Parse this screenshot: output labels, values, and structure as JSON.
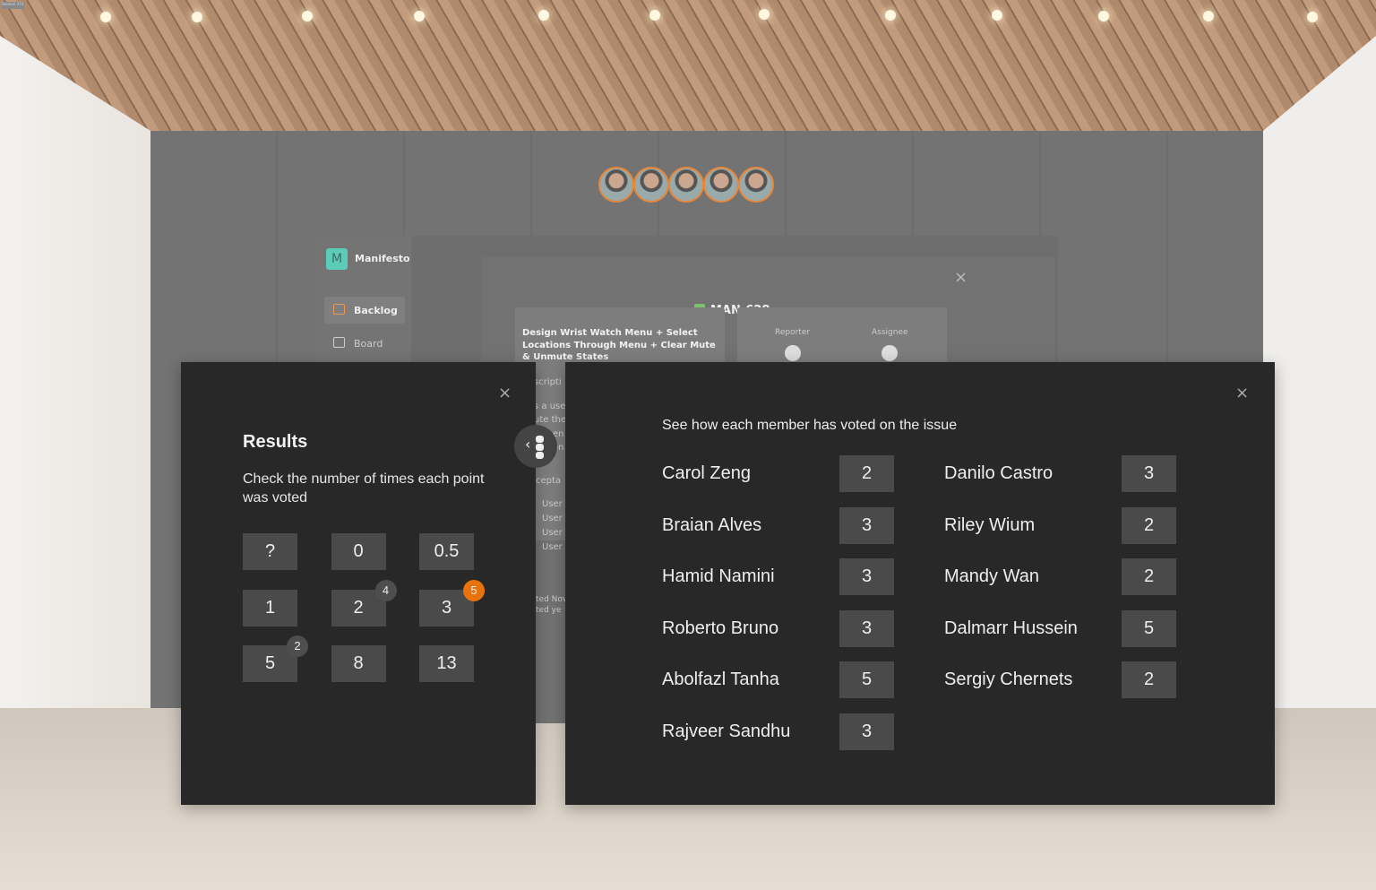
{
  "session_tag": "Session 374",
  "app": {
    "brand": "Manifesto",
    "brand_initial": "M",
    "nav": [
      {
        "label": "Backlog",
        "active": true
      },
      {
        "label": "Board",
        "active": false
      }
    ]
  },
  "issue": {
    "key": "MAN-628",
    "title": "Design Wrist Watch Menu + Select Locations Through Menu + Clear Mute & Unmute States",
    "reporter_label": "Reporter",
    "assignee_label": "Assignee",
    "fragments": [
      "scripti",
      "s a use",
      "ute the",
      "en",
      "on",
      "cepta",
      "User",
      "User",
      "User",
      "User",
      "ted Nov",
      "ted ye"
    ]
  },
  "participants": [
    "participant-1",
    "participant-2",
    "participant-3",
    "participant-4",
    "participant-5"
  ],
  "results": {
    "title": "Results",
    "subtitle": "Check the number of times each point was voted",
    "points": [
      {
        "label": "?",
        "count": null
      },
      {
        "label": "0",
        "count": null
      },
      {
        "label": "0.5",
        "count": null
      },
      {
        "label": "1",
        "count": null
      },
      {
        "label": "2",
        "count": "4"
      },
      {
        "label": "3",
        "count": "5",
        "highlight": true
      },
      {
        "label": "5",
        "count": "2"
      },
      {
        "label": "8",
        "count": null
      },
      {
        "label": "13",
        "count": null
      }
    ]
  },
  "votes": {
    "heading": "See how each member has voted on the issue",
    "members": [
      {
        "name": "Carol Zeng",
        "vote": "2"
      },
      {
        "name": "Braian Alves",
        "vote": "3"
      },
      {
        "name": "Hamid Namini",
        "vote": "3"
      },
      {
        "name": "Roberto Bruno",
        "vote": "3"
      },
      {
        "name": "Abolfazl Tanha",
        "vote": "5"
      },
      {
        "name": "Rajveer Sandhu",
        "vote": "3"
      },
      {
        "name": "Danilo Castro",
        "vote": "3"
      },
      {
        "name": "Riley Wium",
        "vote": "2"
      },
      {
        "name": "Mandy Wan",
        "vote": "2"
      },
      {
        "name": "Dalmarr Hussein",
        "vote": "5"
      },
      {
        "name": "Sergiy Chernets",
        "vote": "2"
      }
    ]
  },
  "colors": {
    "accent": "#e8720c",
    "avatar_ring": "#e8873a",
    "panel": "#282828",
    "chip": "#4a4a4a"
  }
}
